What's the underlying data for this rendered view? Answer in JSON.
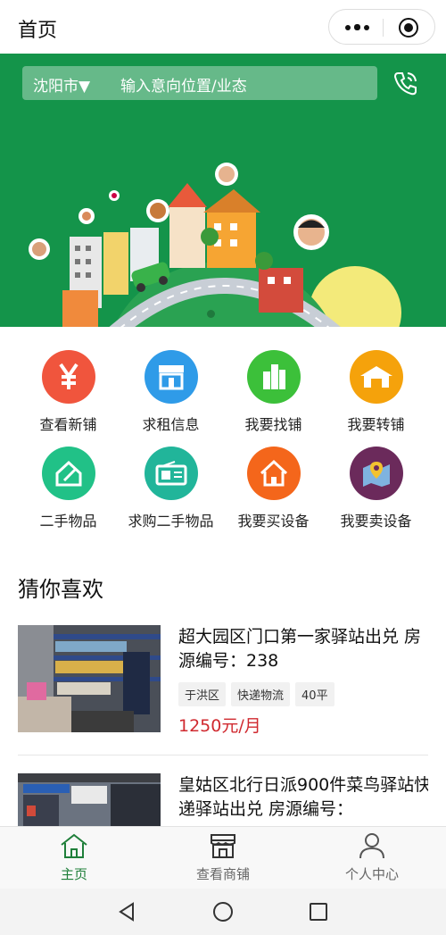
{
  "header": {
    "title": "首页"
  },
  "colors": {
    "brand_green": "#14944a",
    "price_red": "#d0292f",
    "tab_active": "#1f7f3a",
    "tab_inactive": "#666666"
  },
  "banner": {
    "city": "沈阳市▼",
    "search_placeholder": "输入意向位置/业态",
    "phone_icon": "phone-icon",
    "carousel_active_index": 2,
    "carousel_count": 2
  },
  "menu": [
    {
      "label": "查看新铺",
      "icon": "yuan-icon",
      "color": "#f0553d"
    },
    {
      "label": "求租信息",
      "icon": "storefront-icon",
      "color": "#2f9be8"
    },
    {
      "label": "我要找铺",
      "icon": "buildings-icon",
      "color": "#3cc03a"
    },
    {
      "label": "我要转铺",
      "icon": "house-icon",
      "color": "#f5a20b"
    },
    {
      "label": "二手物品",
      "icon": "house-outline-icon",
      "color": "#21c187"
    },
    {
      "label": "求购二手物品",
      "icon": "radio-icon",
      "color": "#21b59a"
    },
    {
      "label": "我要买设备",
      "icon": "home-door-icon",
      "color": "#f4661b"
    },
    {
      "label": "我要卖设备",
      "icon": "map-pin-icon",
      "color": "#6b2a5b"
    }
  ],
  "section": {
    "title": "猜你喜欢"
  },
  "listings": [
    {
      "title": "超大园区门口第一家驿站出兑 房源编号：238",
      "tags": [
        "于洪区",
        "快递物流",
        "40平"
      ],
      "price": "1250元/月"
    },
    {
      "title": "皇姑区北行日派900件菜鸟驿站快递驿站出兑 房源编号："
    }
  ],
  "tabbar": [
    {
      "label": "主页",
      "icon": "home-icon",
      "active": true
    },
    {
      "label": "查看商铺",
      "icon": "shop-icon",
      "active": false
    },
    {
      "label": "个人中心",
      "icon": "user-icon",
      "active": false
    }
  ]
}
